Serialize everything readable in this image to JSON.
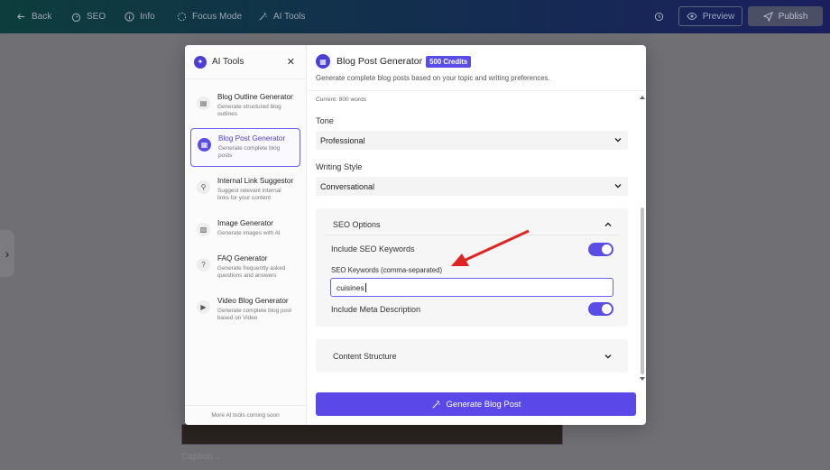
{
  "topbar": {
    "back": "Back",
    "seo": "SEO",
    "info": "Info",
    "focus_mode": "Focus Mode",
    "ai_tools": "AI Tools",
    "preview": "Preview",
    "publish": "Publish"
  },
  "editor": {
    "caption_placeholder": "Caption..."
  },
  "sidebar": {
    "title": "AI Tools",
    "footer": "More AI tools coming soon",
    "tools": [
      {
        "name": "Blog Outline Generator",
        "desc": "Generate structured blog outlines",
        "icon": "document-icon"
      },
      {
        "name": "Blog Post Generator",
        "desc": "Generate complete blog posts",
        "icon": "article-icon",
        "active": true
      },
      {
        "name": "Internal Link Suggestor",
        "desc": "Suggest relevant internal links for your content",
        "icon": "link-icon"
      },
      {
        "name": "Image Generator",
        "desc": "Generate images with AI",
        "icon": "image-icon"
      },
      {
        "name": "FAQ Generator",
        "desc": "Generate frequently asked questions and answers",
        "icon": "question-icon"
      },
      {
        "name": "Video Blog Generator",
        "desc": "Generate complete blog post based on Video",
        "icon": "video-icon"
      }
    ]
  },
  "main": {
    "title": "Blog Post Generator",
    "credits": "500 Credits",
    "subtitle": "Generate complete blog posts based on your topic and writing preferences.",
    "current_words": "Current: 800 words",
    "tone_label": "Tone",
    "tone_value": "Professional",
    "style_label": "Writing Style",
    "style_value": "Conversational",
    "seo_options": {
      "title": "SEO Options",
      "include_keywords_label": "Include SEO Keywords",
      "include_keywords_on": true,
      "keywords_label": "SEO Keywords (comma-separated)",
      "keywords_value": "cuisines",
      "include_meta_label": "Include Meta Description",
      "include_meta_on": true
    },
    "content_structure": "Content Structure",
    "generate_button": "Generate Blog Post"
  },
  "colors": {
    "accent": "#5a4de6",
    "annotation_arrow": "#e02424"
  }
}
